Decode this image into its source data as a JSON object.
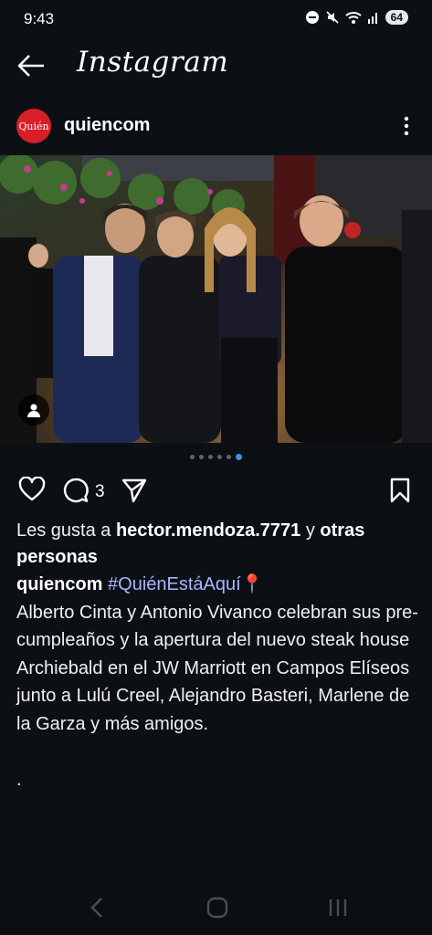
{
  "status_bar": {
    "time": "9:43",
    "battery": "64",
    "icons": [
      "do-not-disturb-icon",
      "mute-icon",
      "wifi-icon",
      "signal-icon",
      "battery-icon"
    ]
  },
  "app": {
    "title": "Instagram",
    "back_icon": "arrow-left-icon"
  },
  "post": {
    "account": {
      "avatar_text": "Quién",
      "username": "quiencom",
      "avatar_color": "#d81f28"
    },
    "carousel": {
      "count": 6,
      "active_index": 5,
      "active_color": "#3797f0"
    },
    "actions": {
      "comment_count": "3",
      "icons": [
        "heart-icon",
        "comment-icon",
        "share-icon",
        "bookmark-icon"
      ]
    },
    "likes": {
      "prefix": "Les gusta a ",
      "user": "hector.mendoza.7771",
      "middle": " y ",
      "others": "otras personas"
    },
    "caption": {
      "username": "quiencom",
      "hashtag": "#QuiénEstáAquí📍",
      "text": "Alberto Cinta y Antonio Vivanco celebran sus pre-cumpleaños y la apertura del nuevo steak house Archiebald en el JW Marriott en Campos Elíseos junto a Lulú Creel, Alejandro Basteri, Marlene de la Garza y más amigos.",
      "trailing": "."
    }
  },
  "colors": {
    "background": "#0c1014",
    "hashtag": "#a9b6ff"
  }
}
